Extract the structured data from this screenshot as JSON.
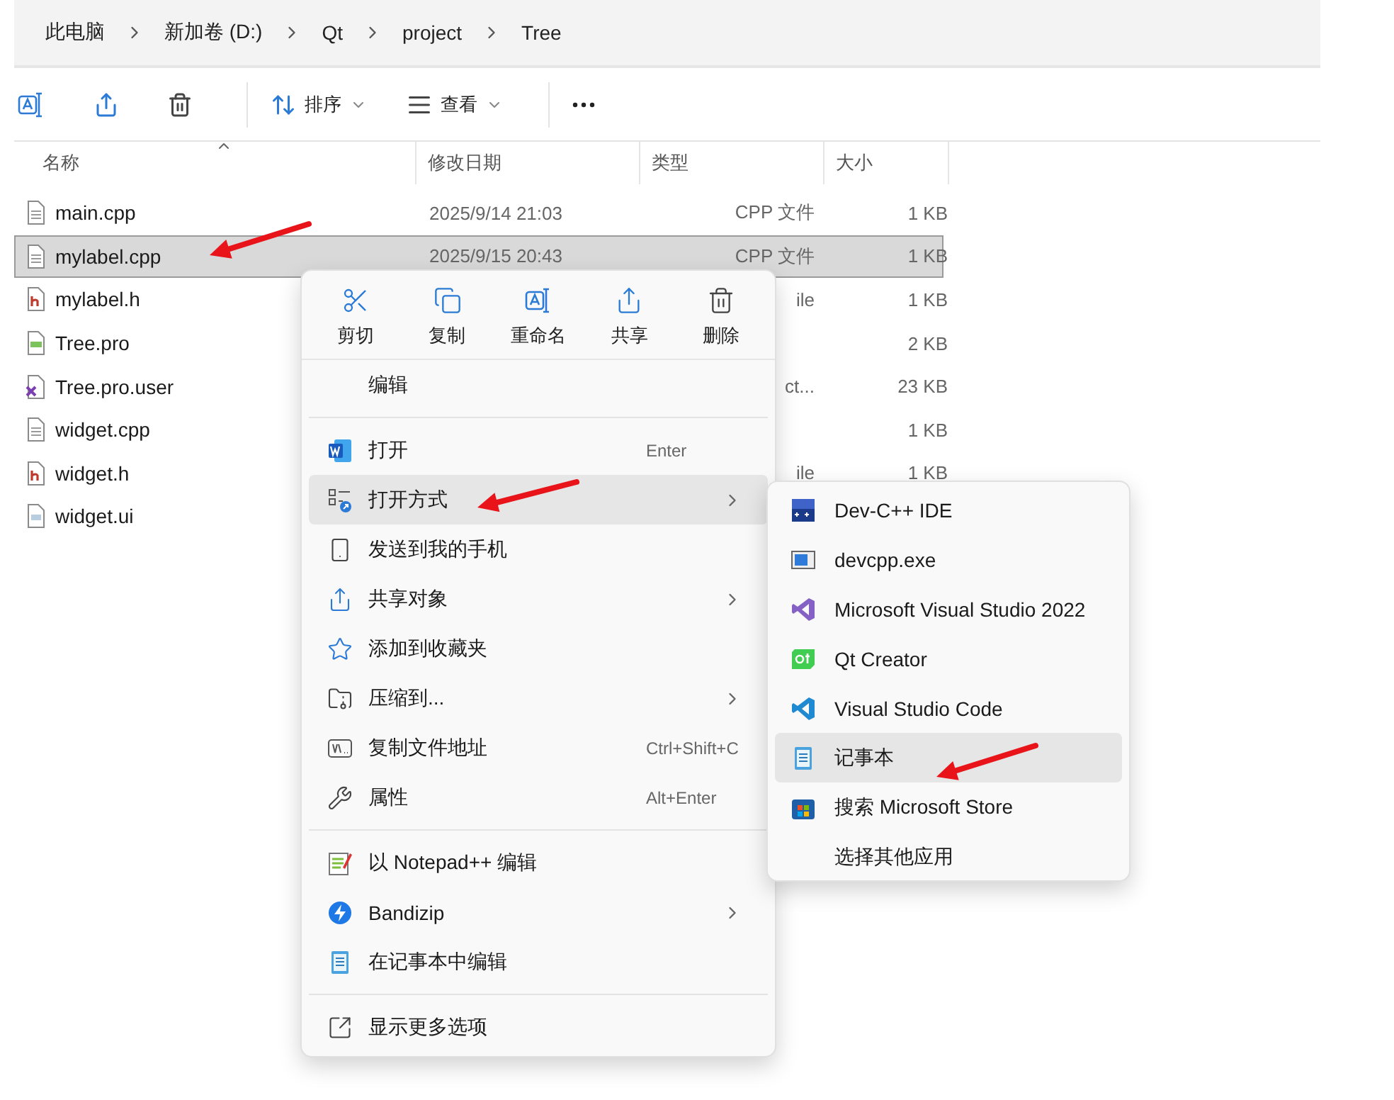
{
  "breadcrumb": [
    "此电脑",
    "新加卷 (D:)",
    "Qt",
    "project",
    "Tree"
  ],
  "toolbar": [
    {
      "kind": "rename"
    },
    {
      "kind": "share"
    },
    {
      "kind": "delete"
    },
    {
      "kind": "sort",
      "label": "排序"
    },
    {
      "kind": "view",
      "label": "查看"
    },
    {
      "kind": "more"
    }
  ],
  "columns": [
    {
      "label": "名称",
      "sorted": true
    },
    {
      "label": "修改日期",
      "sorted": false
    },
    {
      "label": "类型",
      "sorted": false
    },
    {
      "label": "大小",
      "sorted": false
    }
  ],
  "rows": [
    {
      "name": "main.cpp",
      "kind": "text",
      "modified": "2025/9/14 21:03",
      "type": "CPP 文件",
      "size": "1 KB",
      "selected": false
    },
    {
      "name": "mylabel.cpp",
      "kind": "text",
      "modified": "2025/9/15 20:43",
      "type": "CPP 文件",
      "size": "1 KB",
      "selected": true
    },
    {
      "name": "mylabel.h",
      "kind": "header",
      "type": "ile",
      "size": "1 KB",
      "selected": false
    },
    {
      "name": "Tree.pro",
      "kind": "pro",
      "size": "2 KB",
      "selected": false
    },
    {
      "name": "Tree.pro.user",
      "kind": "user",
      "type": "ct...",
      "size": "23 KB",
      "selected": false
    },
    {
      "name": "widget.cpp",
      "kind": "text",
      "size": "1 KB",
      "selected": false
    },
    {
      "name": "widget.h",
      "kind": "header",
      "type": "ile",
      "size": "1 KB",
      "selected": false
    },
    {
      "name": "widget.ui",
      "kind": "ui",
      "selected": false
    }
  ],
  "context_menu": {
    "quick_actions": [
      {
        "label": "剪切",
        "kind": "cut"
      },
      {
        "label": "复制",
        "kind": "copy"
      },
      {
        "label": "重命名",
        "kind": "rename"
      },
      {
        "label": "共享",
        "kind": "share"
      },
      {
        "label": "删除",
        "kind": "delete"
      }
    ],
    "sections": [
      [
        {
          "label": "编辑",
          "selected": false,
          "submenu": false
        }
      ],
      [
        {
          "label": "打开",
          "kind": "word",
          "shortcut": "Enter",
          "selected": false,
          "submenu": false
        },
        {
          "label": "打开方式",
          "kind": "openwith",
          "selected": true,
          "submenu": true
        },
        {
          "label": "发送到我的手机",
          "kind": "phone",
          "selected": false,
          "submenu": false
        },
        {
          "label": "共享对象",
          "kind": "share",
          "selected": false,
          "submenu": true
        },
        {
          "label": "添加到收藏夹",
          "kind": "star",
          "selected": false,
          "submenu": false
        },
        {
          "label": "压缩到...",
          "kind": "zip",
          "selected": false,
          "submenu": true
        },
        {
          "label": "复制文件地址",
          "kind": "path",
          "shortcut": "Ctrl+Shift+C",
          "selected": false,
          "submenu": false
        },
        {
          "label": "属性",
          "kind": "wrench",
          "shortcut": "Alt+Enter",
          "selected": false,
          "submenu": false
        }
      ],
      [
        {
          "label": "以 Notepad++ 编辑",
          "kind": "notepadpp",
          "selected": false,
          "submenu": false
        },
        {
          "label": "Bandizip",
          "kind": "bandizip",
          "selected": false,
          "submenu": true
        },
        {
          "label": "在记事本中编辑",
          "kind": "notepad",
          "selected": false,
          "submenu": false
        }
      ],
      [
        {
          "label": "显示更多选项",
          "kind": "more",
          "selected": false,
          "submenu": false
        }
      ]
    ]
  },
  "open_with_menu": [
    {
      "label": "Dev-C++ IDE",
      "kind": "devcpp",
      "selected": false
    },
    {
      "label": "devcpp.exe",
      "kind": "exe",
      "selected": false
    },
    {
      "label": "Microsoft Visual Studio 2022",
      "kind": "vs",
      "selected": false
    },
    {
      "label": "Qt Creator",
      "kind": "qt",
      "selected": false
    },
    {
      "label": "Visual Studio Code",
      "kind": "vscode",
      "selected": false
    },
    {
      "label": "记事本",
      "kind": "notepad",
      "selected": true
    },
    {
      "label": "搜索 Microsoft Store",
      "kind": "store",
      "selected": false
    },
    {
      "label": "选择其他应用",
      "selected": false
    }
  ]
}
